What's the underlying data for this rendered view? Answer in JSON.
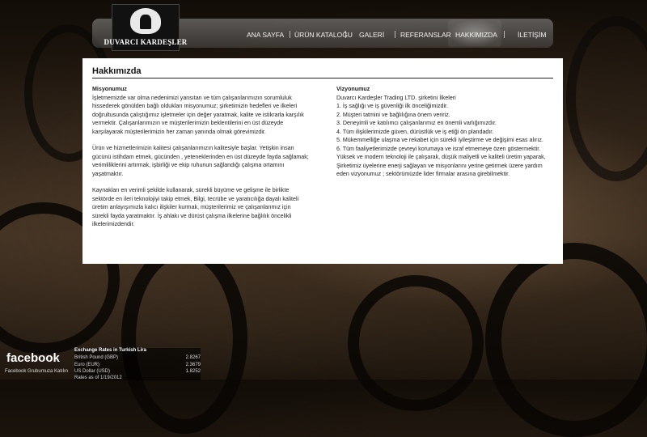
{
  "logo": {
    "text": "DUVARCI KARDEŞLER"
  },
  "nav": {
    "items": [
      "ANA SAYFA",
      "ÜRÜN KATALOĞU",
      "GALERİ",
      "REFERANSLAR",
      "HAKKIMIZDA",
      "İLETİŞİM"
    ],
    "active": "HAKKIMIZDA"
  },
  "panel": {
    "title": "Hakkımızda",
    "mission": {
      "heading": "Misyonumuz",
      "p1": "İşletmemizde var olma nedenimizi yansıtan ve tüm çalışanlarımızın sorumluluk hissederek gönülden bağlı oldukları misyonumuz; şirketimizin hedefleri ve ilkeleri doğrultusunda çalıştığımız işletmeler için değer yaratmak, kalite ve istikrarla karşılık vermektir. Çalışanlarımızın ve müşterilerimizin beklentilerini en üst düzeyde karşılayarak müşterilerimizin her zaman yanında olmak görevimizdir.",
      "p2": "Ürün ve hizmetlerimizin kalitesi çalışanlarımızın kalitesiyle başlar. Yetişkin insan gücünü istihdam etmek, gücünden , yeteneklerinden en üst düzeyde fayda sağlamak; verimliliklerini artırmak, işbirliği ve ekip ruhunun sağlandığı çalışma ortamını yaşatmaktır.",
      "p3": "Kaynakları en verimli şekilde kullanarak, sürekli büyüme ve gelişme ile birlikte sektörde en ileri teknolojiyi takip etmek, Bilgi, tecrübe ve yaratıcılığa dayalı kaliteli üretim anlayışımızla kalıcı ilişkiler kurmak, müşterilerimiz ve çalışanlarımız için sürekli fayda yaratmaktır. İş ahlakı ve dürüst çalışma ilkelerine bağlılık öncelikli ilkelerimizdendir."
    },
    "vision": {
      "heading": "Vizyonumuz",
      "lines": [
        "Duvarcı Kardeşler Trading LTD. şirketini İlkeleri",
        "1. İş sağlığı ve iş güvenliği ilk önceliğimizdir.",
        "2. Müşteri tatmini ve bağlılığına önem veririz.",
        "3. Deneyimli ve katılımcı çalışanlarımız en önemli varlığımızdır.",
        "4. Tüm ilişkilerimizde güven, dürüstlük ve iş etiği ön plandadır.",
        "5. Mükemmelliğe ulaşma ve rekabet için sürekli iyileştirme ve değişimi esas alırız.",
        "6. Tüm faaliyetlerimizde çevreyi korumaya ve israf etmemeye özen göstermektir. Yüksek ve modern teknoloji ile çalışarak, düşük maliyetli ve kaliteli üretim yaparak, Şirketimiz üyelerine enerji sağlayan ve misyonlarını yerine getirmek üzere yardım eden vizyonumuz ; sektörümüzde lider firmalar arasına girebilmektir."
      ]
    }
  },
  "footer": {
    "facebook": "facebook",
    "facebook_sub": "Facebook Grubumuza Katılın",
    "rates": {
      "title": "Exchange Rates in Turkish Lira",
      "rows": [
        {
          "label": "British Pound (GBP)",
          "value": "2.8267"
        },
        {
          "label": "Euro (EUR)",
          "value": "2.3679"
        },
        {
          "label": "US Dollar (USD)",
          "value": "1.8252"
        }
      ],
      "note": "Rates as of 1/19/2012"
    }
  }
}
